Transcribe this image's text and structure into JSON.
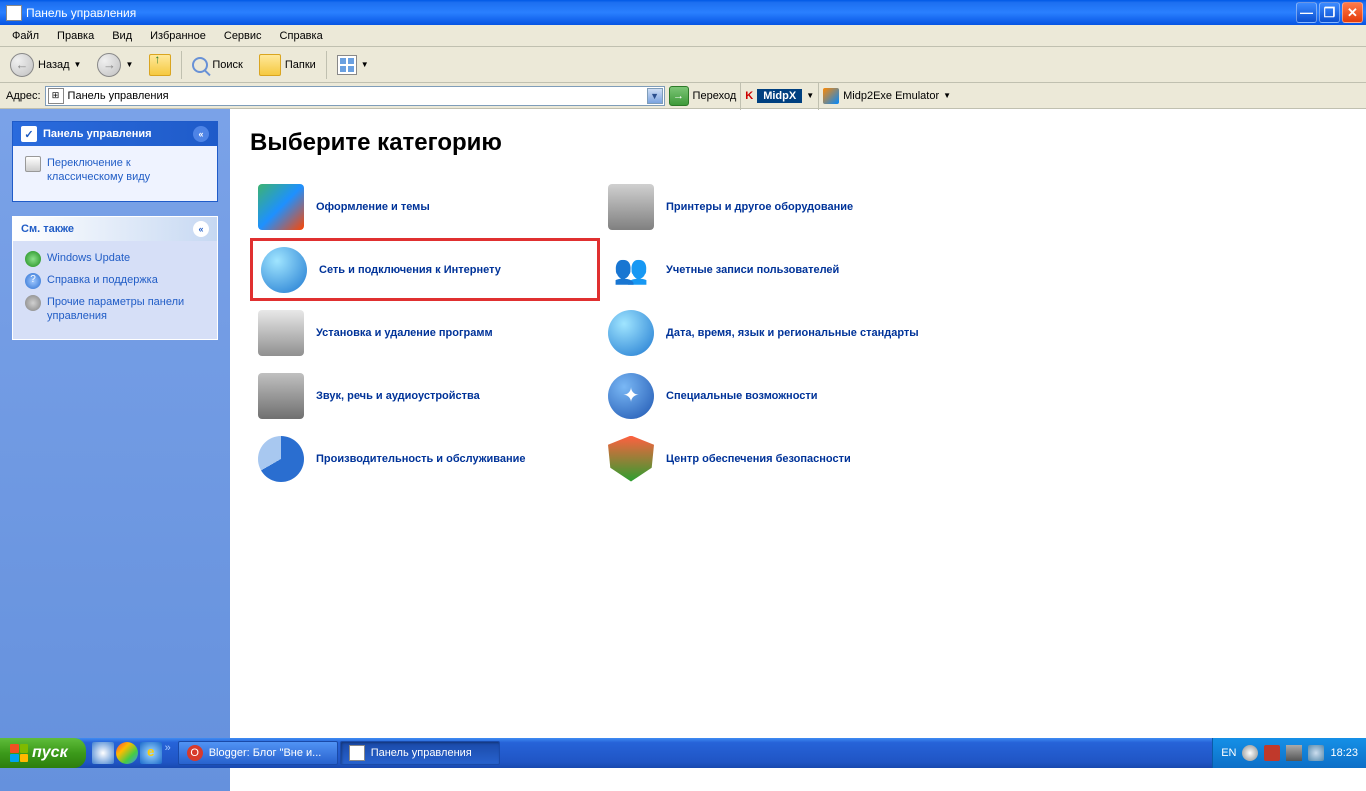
{
  "window": {
    "title": "Панель управления"
  },
  "menubar": [
    "Файл",
    "Правка",
    "Вид",
    "Избранное",
    "Сервис",
    "Справка"
  ],
  "toolbar": {
    "back": "Назад",
    "search": "Поиск",
    "folders": "Папки"
  },
  "addressbar": {
    "label": "Адрес:",
    "value": "Панель управления",
    "go": "Переход",
    "ext1": "MidpX",
    "ext2": "Midp2Exe Emulator"
  },
  "sidebar": {
    "panel1": {
      "title": "Панель управления",
      "link": "Переключение к классическому виду"
    },
    "panel2": {
      "title": "См. также",
      "links": [
        "Windows Update",
        "Справка и поддержка",
        "Прочие параметры панели управления"
      ]
    }
  },
  "content": {
    "heading": "Выберите категорию",
    "categories": [
      {
        "label": "Оформление и темы",
        "icon": "themes"
      },
      {
        "label": "Принтеры и другое оборудование",
        "icon": "printers"
      },
      {
        "label": "Сеть и подключения к Интернету",
        "icon": "network",
        "highlight": true
      },
      {
        "label": "Учетные записи пользователей",
        "icon": "users"
      },
      {
        "label": "Установка и удаление программ",
        "icon": "programs"
      },
      {
        "label": "Дата, время, язык и региональные стандарты",
        "icon": "datetime"
      },
      {
        "label": "Звук, речь и аудиоустройства",
        "icon": "sound"
      },
      {
        "label": "Специальные возможности",
        "icon": "accessibility"
      },
      {
        "label": "Производительность и обслуживание",
        "icon": "performance"
      },
      {
        "label": "Центр обеспечения безопасности",
        "icon": "security"
      }
    ]
  },
  "taskbar": {
    "start": "пуск",
    "buttons": [
      {
        "label": "Blogger: Блог \"Вне и...",
        "active": false
      },
      {
        "label": "Панель управления",
        "active": true
      }
    ],
    "lang": "EN",
    "clock": "18:23"
  },
  "icon_colors": {
    "themes": "linear-gradient(135deg,#3cb371,#1e90ff,#ff4500)",
    "printers": "linear-gradient(to bottom,#d0d0d0,#808080)",
    "network": "radial-gradient(circle at 35% 30%,#a0e5ff,#1e78d0)",
    "users": "linear-gradient(to bottom,#f4c990,#d08030)",
    "programs": "linear-gradient(to bottom,#e8e8e8,#909090)",
    "datetime": "radial-gradient(circle at 35% 30%,#a0e5ff,#1e78d0)",
    "sound": "linear-gradient(to bottom,#c0c0c0,#707070)",
    "accessibility": "radial-gradient(circle at 35% 30%,#7ab8f5,#1e55b0)",
    "performance": "radial-gradient(circle at 50% 50%,#7ab8f5,#2a6ed0)",
    "security": "linear-gradient(to bottom,#ff6040,#2aa030)"
  }
}
